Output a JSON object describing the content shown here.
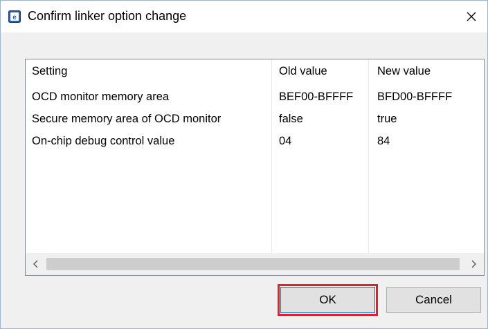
{
  "window": {
    "title": "Confirm linker option change",
    "icon": "app-icon",
    "close_icon": "close-icon"
  },
  "table": {
    "headers": [
      "Setting",
      "Old value",
      "New value"
    ],
    "rows": [
      [
        "OCD monitor memory area",
        "BEF00-BFFFF",
        "BFD00-BFFFF"
      ],
      [
        "Secure memory area of OCD monitor",
        "false",
        "true"
      ],
      [
        "On-chip debug control value",
        "04",
        "84"
      ]
    ]
  },
  "scrollbar": {
    "left_icon": "chevron-left-icon",
    "right_icon": "chevron-right-icon"
  },
  "buttons": {
    "ok_label": "OK",
    "cancel_label": "Cancel"
  },
  "colors": {
    "highlight": "#e0202a",
    "focus": "#0078d7"
  }
}
